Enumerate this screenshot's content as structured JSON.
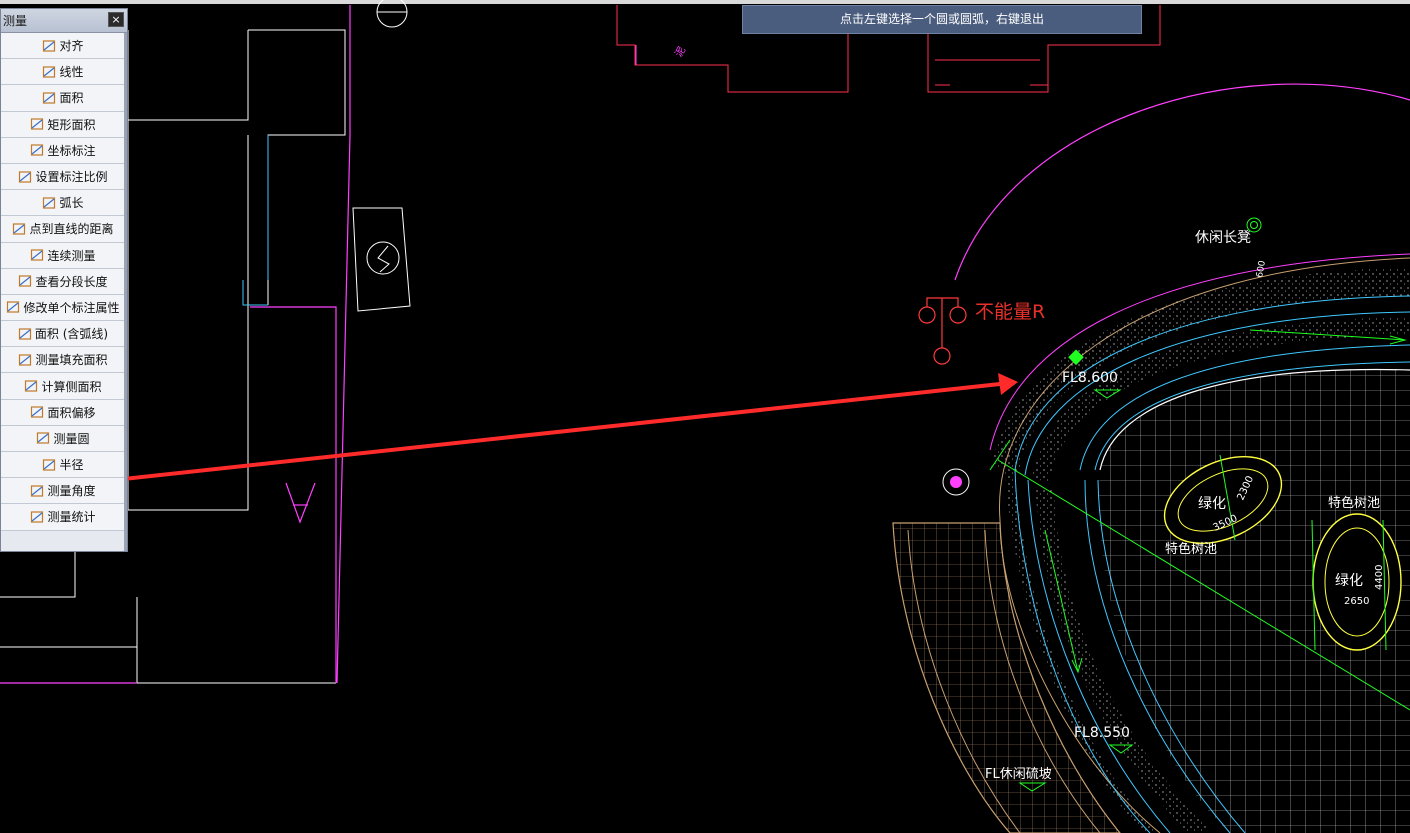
{
  "palette": {
    "title": "测量",
    "close_label": "×",
    "items": [
      {
        "label": "对齐",
        "icon": "aligned-dimension-icon"
      },
      {
        "label": "线性",
        "icon": "linear-dimension-icon"
      },
      {
        "label": "面积",
        "icon": "area-icon"
      },
      {
        "label": "矩形面积",
        "icon": "rect-area-icon"
      },
      {
        "label": "坐标标注",
        "icon": "coordinate-icon"
      },
      {
        "label": "设置标注比例",
        "icon": "scale-icon"
      },
      {
        "label": "弧长",
        "icon": "arc-length-icon"
      },
      {
        "label": "点到直线的距离",
        "icon": "point-line-distance-icon"
      },
      {
        "label": "连续测量",
        "icon": "continuous-measure-icon"
      },
      {
        "label": "查看分段长度",
        "icon": "segment-length-icon"
      },
      {
        "label": "修改单个标注属性",
        "icon": "edit-dimension-icon"
      },
      {
        "label": "面积 (含弧线)",
        "icon": "arc-area-icon"
      },
      {
        "label": "测量填充面积",
        "icon": "hatch-area-icon"
      },
      {
        "label": "计算侧面积",
        "icon": "side-area-icon"
      },
      {
        "label": "面积偏移",
        "icon": "area-offset-icon"
      },
      {
        "label": "测量圆",
        "icon": "measure-circle-icon"
      },
      {
        "label": "半径",
        "icon": "radius-icon"
      },
      {
        "label": "测量角度",
        "icon": "angle-icon"
      },
      {
        "label": "测量统计",
        "icon": "statistics-icon"
      }
    ]
  },
  "status_tip": "点击左键选择一个圆或圆弧，右键退出",
  "annotation": {
    "text": "不能量R",
    "color": "#e8302a"
  },
  "drawing_labels": {
    "bench": "休闲长凳",
    "fl_upper": "FL8.600",
    "fl_lower": "FL8.550",
    "pool_left_top": "绿化",
    "pool_left_dim_a": "2300",
    "pool_left_dim_b": "3500",
    "pool_left_caption": "特色树池",
    "pool_right_caption": "特色树池",
    "pool_right_top": "绿化",
    "pool_right_dim_a": "4400",
    "pool_right_dim_b": "2650",
    "bottom_overlap": "FL休闲硫坡",
    "bench_dim": "600",
    "top_small": "泥"
  },
  "colors": {
    "background": "#000000",
    "magenta": "#ff40ff",
    "red": "#ff2020",
    "green": "#20ff20",
    "cyan": "#40c8ff",
    "yellow": "#ffff40",
    "tan": "#c8a070",
    "white": "#ffffff",
    "arrow": "#ff2a2a"
  }
}
